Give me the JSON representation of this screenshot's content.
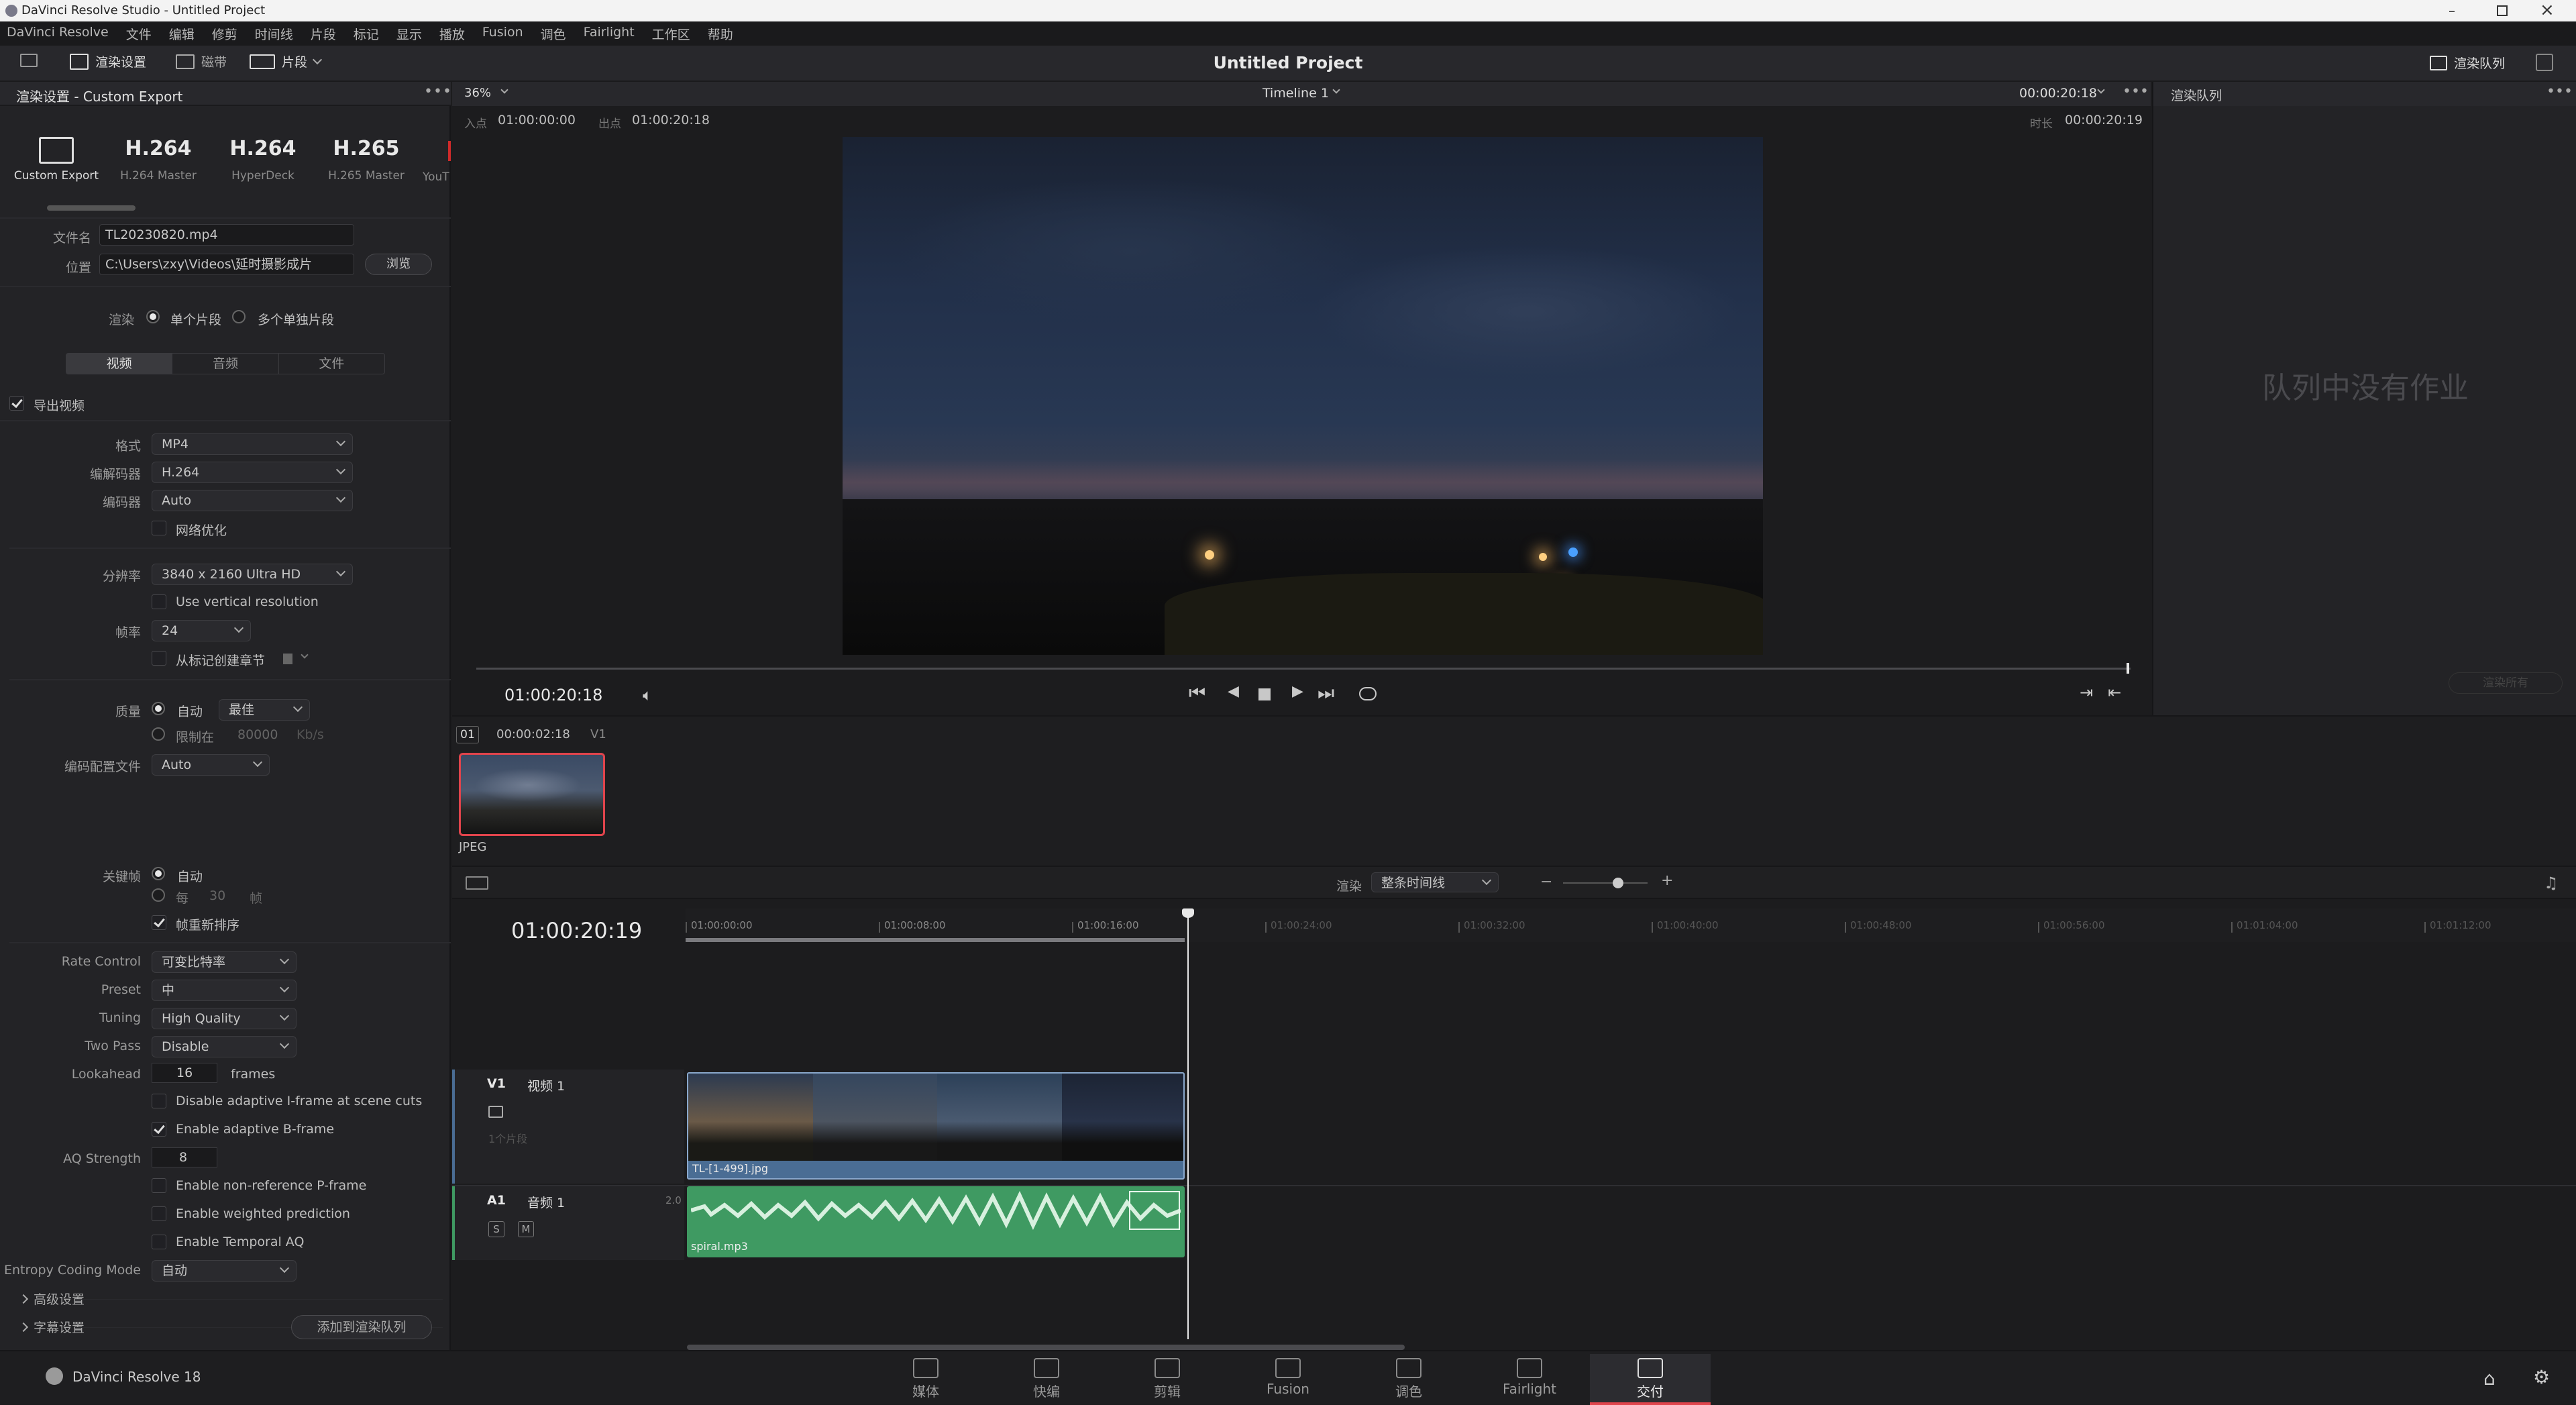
{
  "window": {
    "title": "DaVinci Resolve Studio - Untitled Project"
  },
  "menubar": [
    "DaVinci Resolve",
    "文件",
    "编辑",
    "修剪",
    "时间线",
    "片段",
    "标记",
    "显示",
    "播放",
    "Fusion",
    "调色",
    "Fairlight",
    "工作区",
    "帮助"
  ],
  "toolbar": {
    "render_settings": "渲染设置",
    "clips_label": "片段",
    "tape_label": "磁带",
    "project_title": "Untitled Project",
    "render_queue": "渲染队列"
  },
  "left": {
    "panel_title": "渲染设置 - Custom Export",
    "presets": [
      {
        "big": "",
        "label": "Custom Export"
      },
      {
        "big": "H.264",
        "label": "H.264 Master"
      },
      {
        "big": "H.264",
        "label": "HyperDeck"
      },
      {
        "big": "H.265",
        "label": "H.265 Master"
      },
      {
        "big": "",
        "label": "YouT"
      }
    ],
    "filename_label": "文件名",
    "filename": "TL20230820.mp4",
    "location_label": "位置",
    "location": "C:\\Users\\zxy\\Videos\\延时摄影成片",
    "browse": "浏览",
    "render_label": "渲染",
    "single_clip": "单个片段",
    "multi_clip": "多个单独片段",
    "tabs": [
      "视频",
      "音频",
      "文件"
    ],
    "export_video": "导出视频",
    "format_label": "格式",
    "format": "MP4",
    "codec_label": "编解码器",
    "codec": "H.264",
    "encoder_label": "编码器",
    "encoder": "Auto",
    "network_opt": "网络优化",
    "resolution_label": "分辨率",
    "resolution": "3840 x 2160 Ultra HD",
    "vertical": "Use vertical resolution",
    "framerate_label": "帧率",
    "framerate": "24",
    "chapters": "从标记创建章节",
    "quality_label": "质量",
    "quality_auto": "自动",
    "quality_value": "最佳",
    "limit_label": "限制在",
    "limit_value": "80000",
    "limit_unit": "Kb/s",
    "profile_label": "编码配置文件",
    "profile": "Auto",
    "keyframe_label": "关键帧",
    "keyframe_auto": "自动",
    "keyframe_every": "每",
    "keyframe_n": "30",
    "keyframe_unit": "帧",
    "reorder": "帧重新排序",
    "rate_control_label": "Rate Control",
    "rate_control": "可变比特率",
    "preset_label": "Preset",
    "preset": "中",
    "tuning_label": "Tuning",
    "tuning": "High Quality",
    "twopass_label": "Two Pass",
    "twopass": "Disable",
    "lookahead_label": "Lookahead",
    "lookahead": "16",
    "lookahead_unit": "frames",
    "adaptive_i": "Disable adaptive I-frame at scene cuts",
    "adaptive_b": "Enable adaptive B-frame",
    "aq_label": "AQ Strength",
    "aq": "8",
    "nonref_p": "Enable non-reference P-frame",
    "weighted": "Enable weighted prediction",
    "temporal_aq": "Enable Temporal AQ",
    "entropy_label": "Entropy Coding Mode",
    "entropy": "自动",
    "advanced": "高级设置",
    "subtitle": "字幕设置",
    "add_queue": "添加到渲染队列"
  },
  "viewer": {
    "zoom": "36%",
    "timeline_name": "Timeline 1",
    "tc_top": "00:00:20:18",
    "in_label": "入点",
    "in_tc": "01:00:00:00",
    "out_label": "出点",
    "out_tc": "01:00:20:18",
    "dur_label": "时长",
    "dur_tc": "00:00:20:19",
    "current_tc": "01:00:20:18"
  },
  "clips": {
    "index": "01",
    "tc": "00:00:02:18",
    "track": "V1",
    "type": "JPEG"
  },
  "timeline": {
    "render_label": "渲染",
    "render_mode": "整条时间线",
    "current_tc": "01:00:20:19",
    "ruler": [
      "01:00:00:00",
      "01:00:08:00",
      "01:00:16:00",
      "01:00:24:00",
      "01:00:32:00",
      "01:00:40:00",
      "01:00:48:00",
      "01:00:56:00",
      "01:01:04:00",
      "01:01:12:00"
    ],
    "v1_tag": "V1",
    "v1_name": "视频 1",
    "v1_count": "1个片段",
    "v1_clip": "TL-[1-499].jpg",
    "a1_tag": "A1",
    "a1_name": "音频 1",
    "a1_ch": "2.0",
    "a1_clip": "spiral.mp3",
    "solo": "S",
    "mute": "M"
  },
  "queue": {
    "title": "渲染队列",
    "empty": "队列中没有作业",
    "render_all": "渲染所有"
  },
  "bottom": {
    "app": "DaVinci Resolve 18",
    "pages": [
      "媒体",
      "快编",
      "剪辑",
      "Fusion",
      "调色",
      "Fairlight",
      "交付"
    ],
    "active_page": "交付"
  },
  "colors": {
    "accent": "#e0444c",
    "audio": "#3f9a62",
    "video": "#4a6d94"
  }
}
